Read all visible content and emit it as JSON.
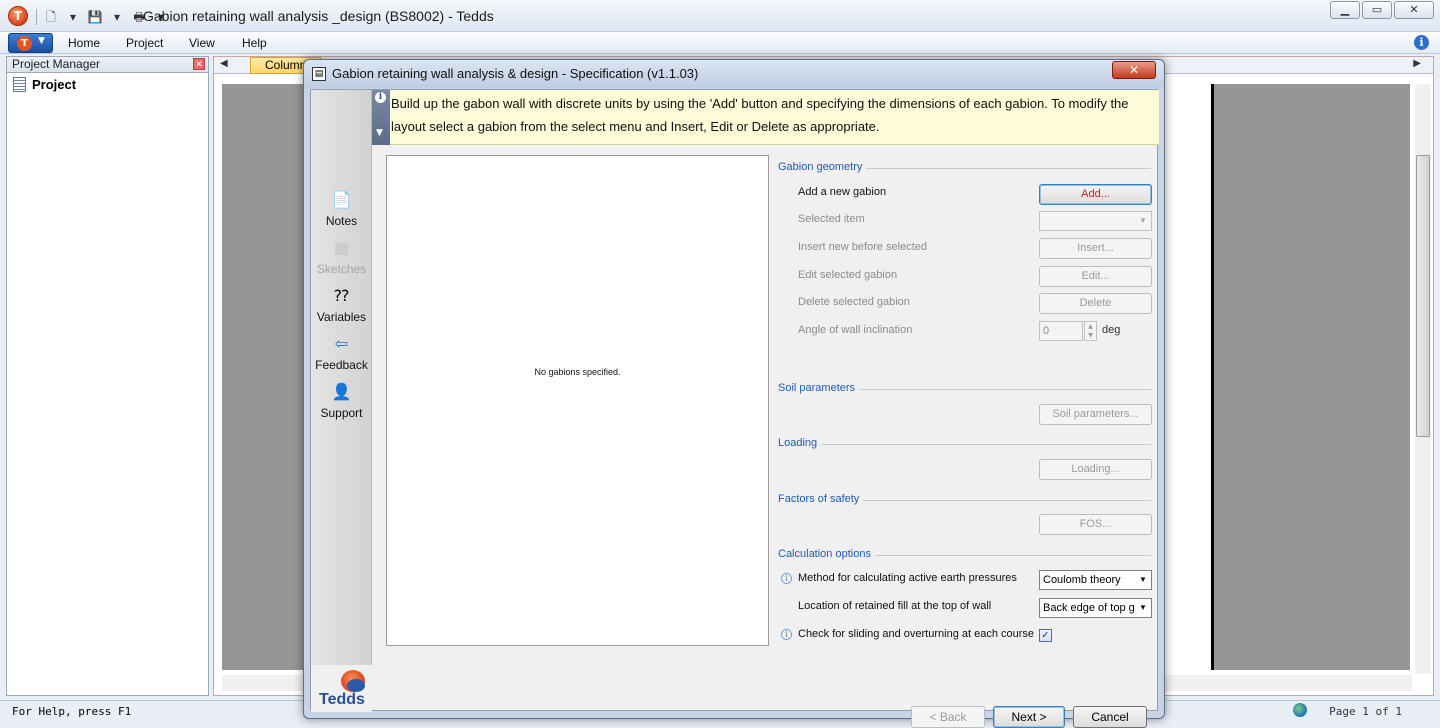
{
  "window": {
    "title": "Gabion retaining wall analysis _design (BS8002) - Tedds",
    "app_logo_letter": "T"
  },
  "menu": {
    "items": [
      "Home",
      "Project",
      "View",
      "Help"
    ]
  },
  "project_manager": {
    "header": "Project Manager",
    "root_item": "Project"
  },
  "document": {
    "tab_label": "Column"
  },
  "status_bar": {
    "help_text": "For Help, press F1",
    "page_text": "Page 1 of 1"
  },
  "dialog": {
    "title": "Gabion retaining wall analysis & design - Specification (v1.1.03)",
    "banner_text": "Build up the gabon wall with discrete units by using the 'Add' button and specifying the dimensions of each gabion. To modify the layout select a gabion from the select menu and Insert, Edit or Delete as appropriate.",
    "nav": [
      {
        "label": "Notes",
        "icon": "notes-icon",
        "enabled": true
      },
      {
        "label": "Sketches",
        "icon": "sketches-icon",
        "enabled": false
      },
      {
        "label": "Variables",
        "icon": "variables-icon",
        "enabled": true
      },
      {
        "label": "Feedback",
        "icon": "feedback-icon",
        "enabled": true
      },
      {
        "label": "Support",
        "icon": "support-icon",
        "enabled": true
      }
    ],
    "logo_text": "Tedds",
    "preview_message": "No gabions specified.",
    "sections": {
      "geometry": "Gabion geometry",
      "soil": "Soil parameters",
      "loading": "Loading",
      "fos": "Factors of safety",
      "calc": "Calculation options"
    },
    "geometry": {
      "add_label": "Add a new gabion",
      "add_button": "Add...",
      "selected_label": "Selected item",
      "selected_value": "",
      "insert_label": "Insert new before selected",
      "insert_button": "Insert...",
      "edit_label": "Edit selected gabion",
      "edit_button": "Edit...",
      "delete_label": "Delete selected gabion",
      "delete_button": "Delete",
      "angle_label": "Angle of wall inclination",
      "angle_value": "0",
      "angle_unit": "deg"
    },
    "soil_button": "Soil parameters...",
    "loading_button": "Loading...",
    "fos_button": "FOS...",
    "calc": {
      "method_label": "Method for calculating active earth pressures",
      "method_value": "Coulomb theory",
      "location_label": "Location of retained fill at the top of wall",
      "location_value": "Back edge of top g",
      "check_label": "Check for sliding and overturning at each course",
      "check_value": true
    },
    "footer": {
      "back": "< Back",
      "next": "Next >",
      "cancel": "Cancel"
    }
  },
  "colors": {
    "section_heading": "#1f5bb5",
    "banner_background": "#fdfbd8",
    "add_button_text": "#d21a1a"
  }
}
